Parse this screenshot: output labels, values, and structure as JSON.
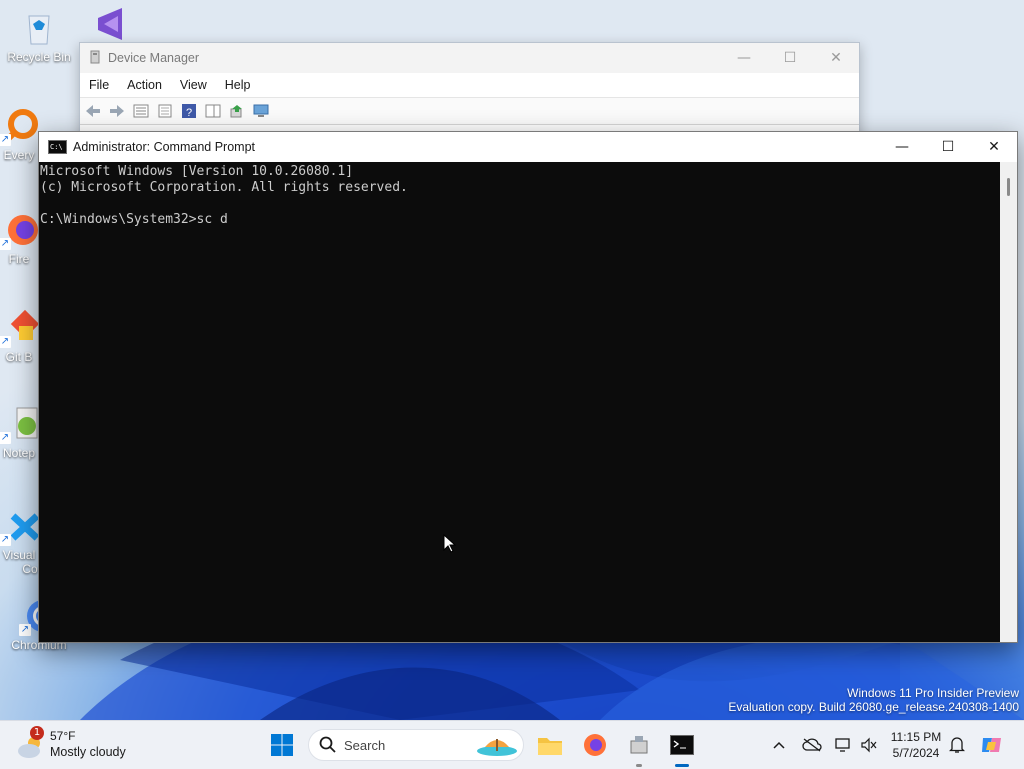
{
  "desktop": {
    "icons": [
      {
        "label": "Recycle Bin",
        "icon": "recycle-bin-icon"
      },
      {
        "label": "Every",
        "icon": "everything-search-icon"
      },
      {
        "label": "Fire",
        "icon": "firefox-icon"
      },
      {
        "label": "Git B",
        "icon": "git-bash-icon"
      },
      {
        "label": "Notep",
        "icon": "notepad-plus-plus-icon"
      },
      {
        "label": "Visual",
        "label2": "Co",
        "icon": "vscode-icon"
      },
      {
        "label": "Chromium",
        "icon": "chromium-icon"
      }
    ],
    "watermark": {
      "line1": "Windows 11 Pro Insider Preview",
      "line2": "Evaluation copy. Build 26080.ge_release.240308-1400"
    }
  },
  "device_manager": {
    "title": "Device Manager",
    "menu": [
      "File",
      "Action",
      "View",
      "Help"
    ]
  },
  "cmd": {
    "title": "Administrator: Command Prompt",
    "lines": [
      "Microsoft Windows [Version 10.0.26080.1]",
      "(c) Microsoft Corporation. All rights reserved.",
      "",
      "C:\\Windows\\System32>sc d"
    ],
    "background": "#0c0c0c",
    "foreground": "#cccccc"
  },
  "taskbar": {
    "weather": {
      "temp": "57°F",
      "desc": "Mostly cloudy",
      "badge": "1"
    },
    "search_label": "Search",
    "clock": {
      "time": "11:15 PM",
      "date": "5/7/2024"
    },
    "accent": "#0067c0"
  }
}
